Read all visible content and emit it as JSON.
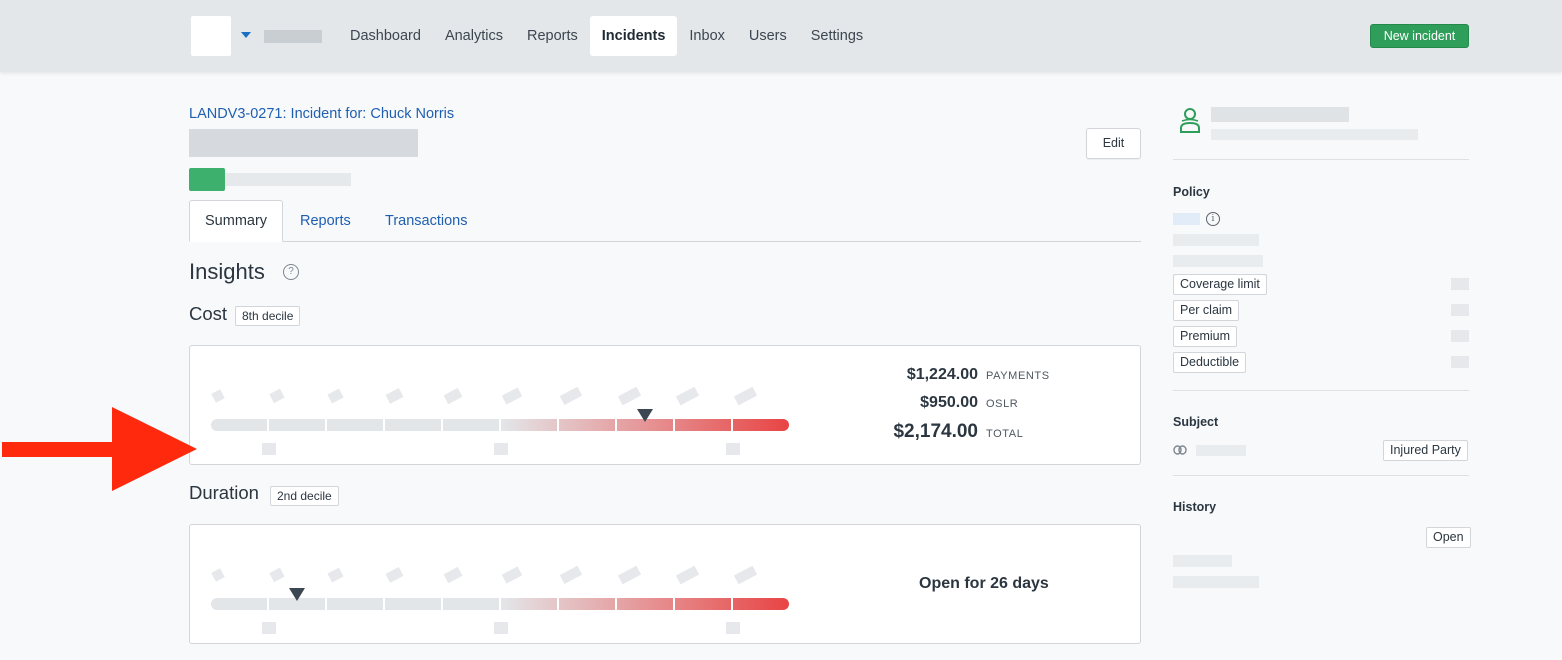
{
  "nav": {
    "items": [
      {
        "label": "Dashboard",
        "active": false
      },
      {
        "label": "Analytics",
        "active": false
      },
      {
        "label": "Reports",
        "active": false
      },
      {
        "label": "Incidents",
        "active": true
      },
      {
        "label": "Inbox",
        "active": false
      },
      {
        "label": "Users",
        "active": false
      },
      {
        "label": "Settings",
        "active": false
      }
    ],
    "new_incident_label": "New incident"
  },
  "incident": {
    "link_text": "LANDV3-0271: Incident for: Chuck Norris",
    "edit_label": "Edit"
  },
  "tabs": [
    {
      "label": "Summary",
      "active": true
    },
    {
      "label": "Reports",
      "active": false
    },
    {
      "label": "Transactions",
      "active": false
    }
  ],
  "insights": {
    "heading": "Insights",
    "help_glyph": "?",
    "cost": {
      "title": "Cost",
      "decile_badge": "8th decile",
      "decile": 8,
      "payments_value": "$1,224.00",
      "payments_label": "PAYMENTS",
      "oslr_value": "$950.00",
      "oslr_label": "OSLR",
      "total_value": "$2,174.00",
      "total_label": "TOTAL"
    },
    "duration": {
      "title": "Duration",
      "decile_badge": "2nd decile",
      "decile": 2,
      "text": "Open for 26 days"
    }
  },
  "sidebar": {
    "policy": {
      "heading": "Policy",
      "info_glyph": "i",
      "fields": [
        "Coverage limit",
        "Per claim",
        "Premium",
        "Deductible"
      ]
    },
    "subject": {
      "heading": "Subject",
      "tag": "Injured Party"
    },
    "history": {
      "heading": "History",
      "tag": "Open"
    }
  },
  "colors": {
    "accent_green": "#2e9e5a",
    "link_blue": "#1f5fb0",
    "gradient_end_red": "#e84444",
    "annotation_arrow": "#ff2a0e"
  }
}
